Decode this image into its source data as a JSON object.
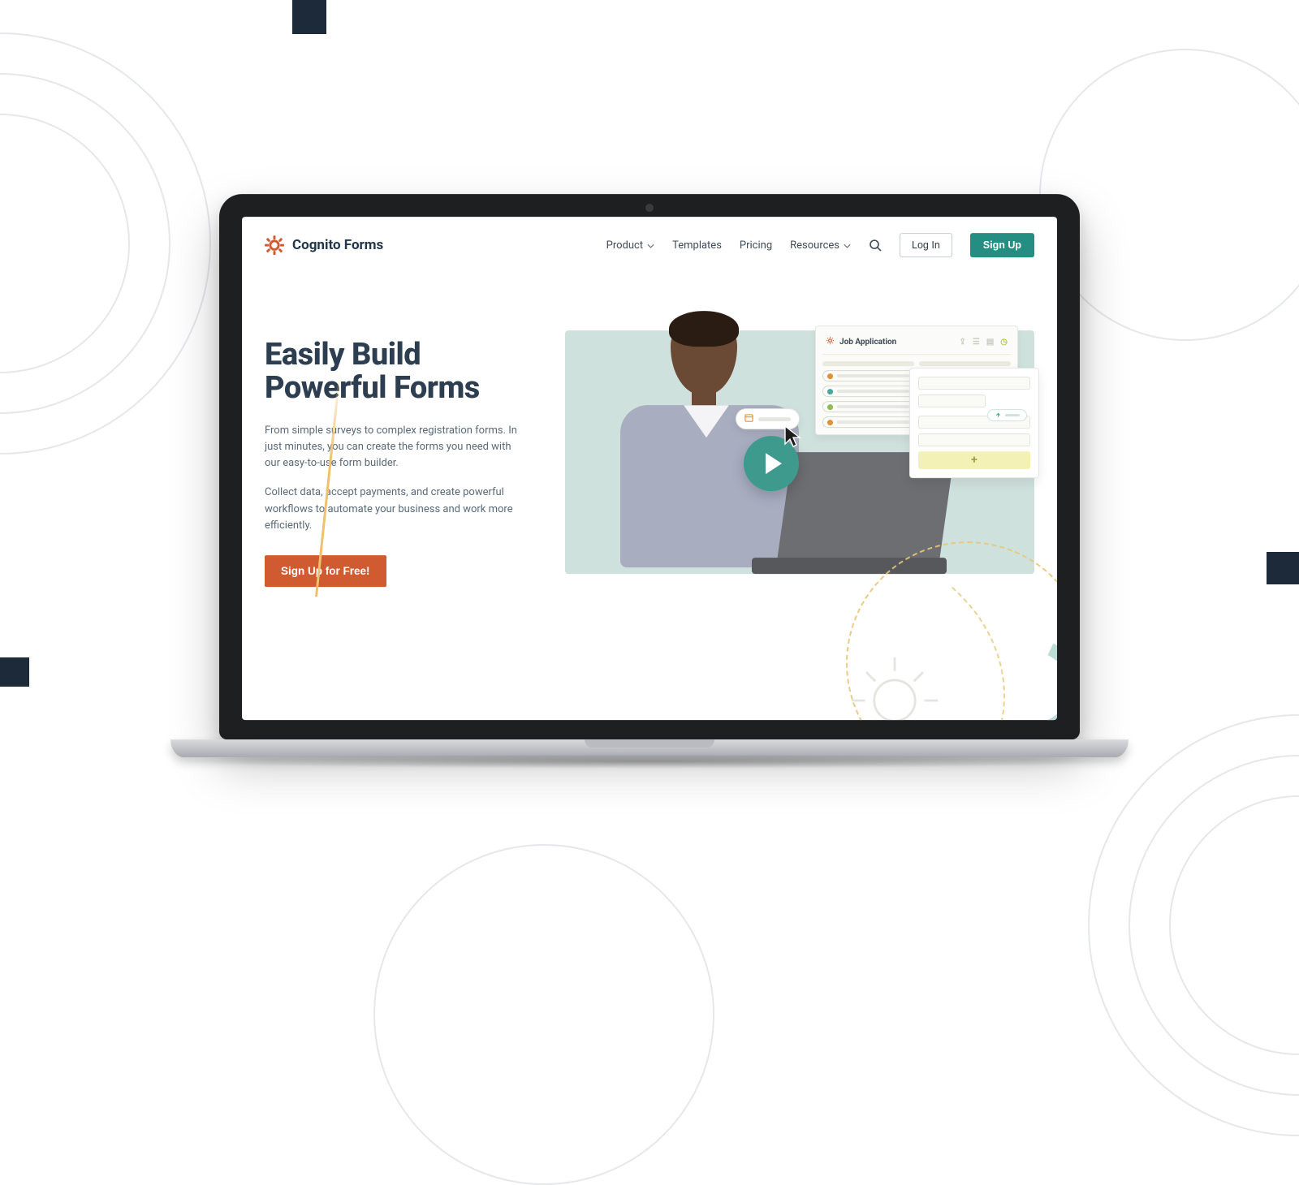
{
  "brand": {
    "name": "Cognito Forms"
  },
  "nav": {
    "items": [
      {
        "label": "Product",
        "has_dropdown": true
      },
      {
        "label": "Templates",
        "has_dropdown": false
      },
      {
        "label": "Pricing",
        "has_dropdown": false
      },
      {
        "label": "Resources",
        "has_dropdown": true
      }
    ],
    "login": "Log In",
    "signup": "Sign Up"
  },
  "hero": {
    "title_line1": "Easily Build",
    "title_line2": "Powerful Forms",
    "paragraph1": "From simple surveys to complex registration forms. In just minutes, you can create the forms you need with our easy-to-use form builder.",
    "paragraph2": "Collect data, accept payments, and create powerful workflows to automate your business and work more efficiently.",
    "cta": "Sign Up for Free!"
  },
  "form_mock": {
    "title": "Job Application",
    "add_label": "+"
  },
  "colors": {
    "brand_orange": "#d15b31",
    "brand_teal": "#248e83",
    "text_dark": "#2c3e50"
  }
}
